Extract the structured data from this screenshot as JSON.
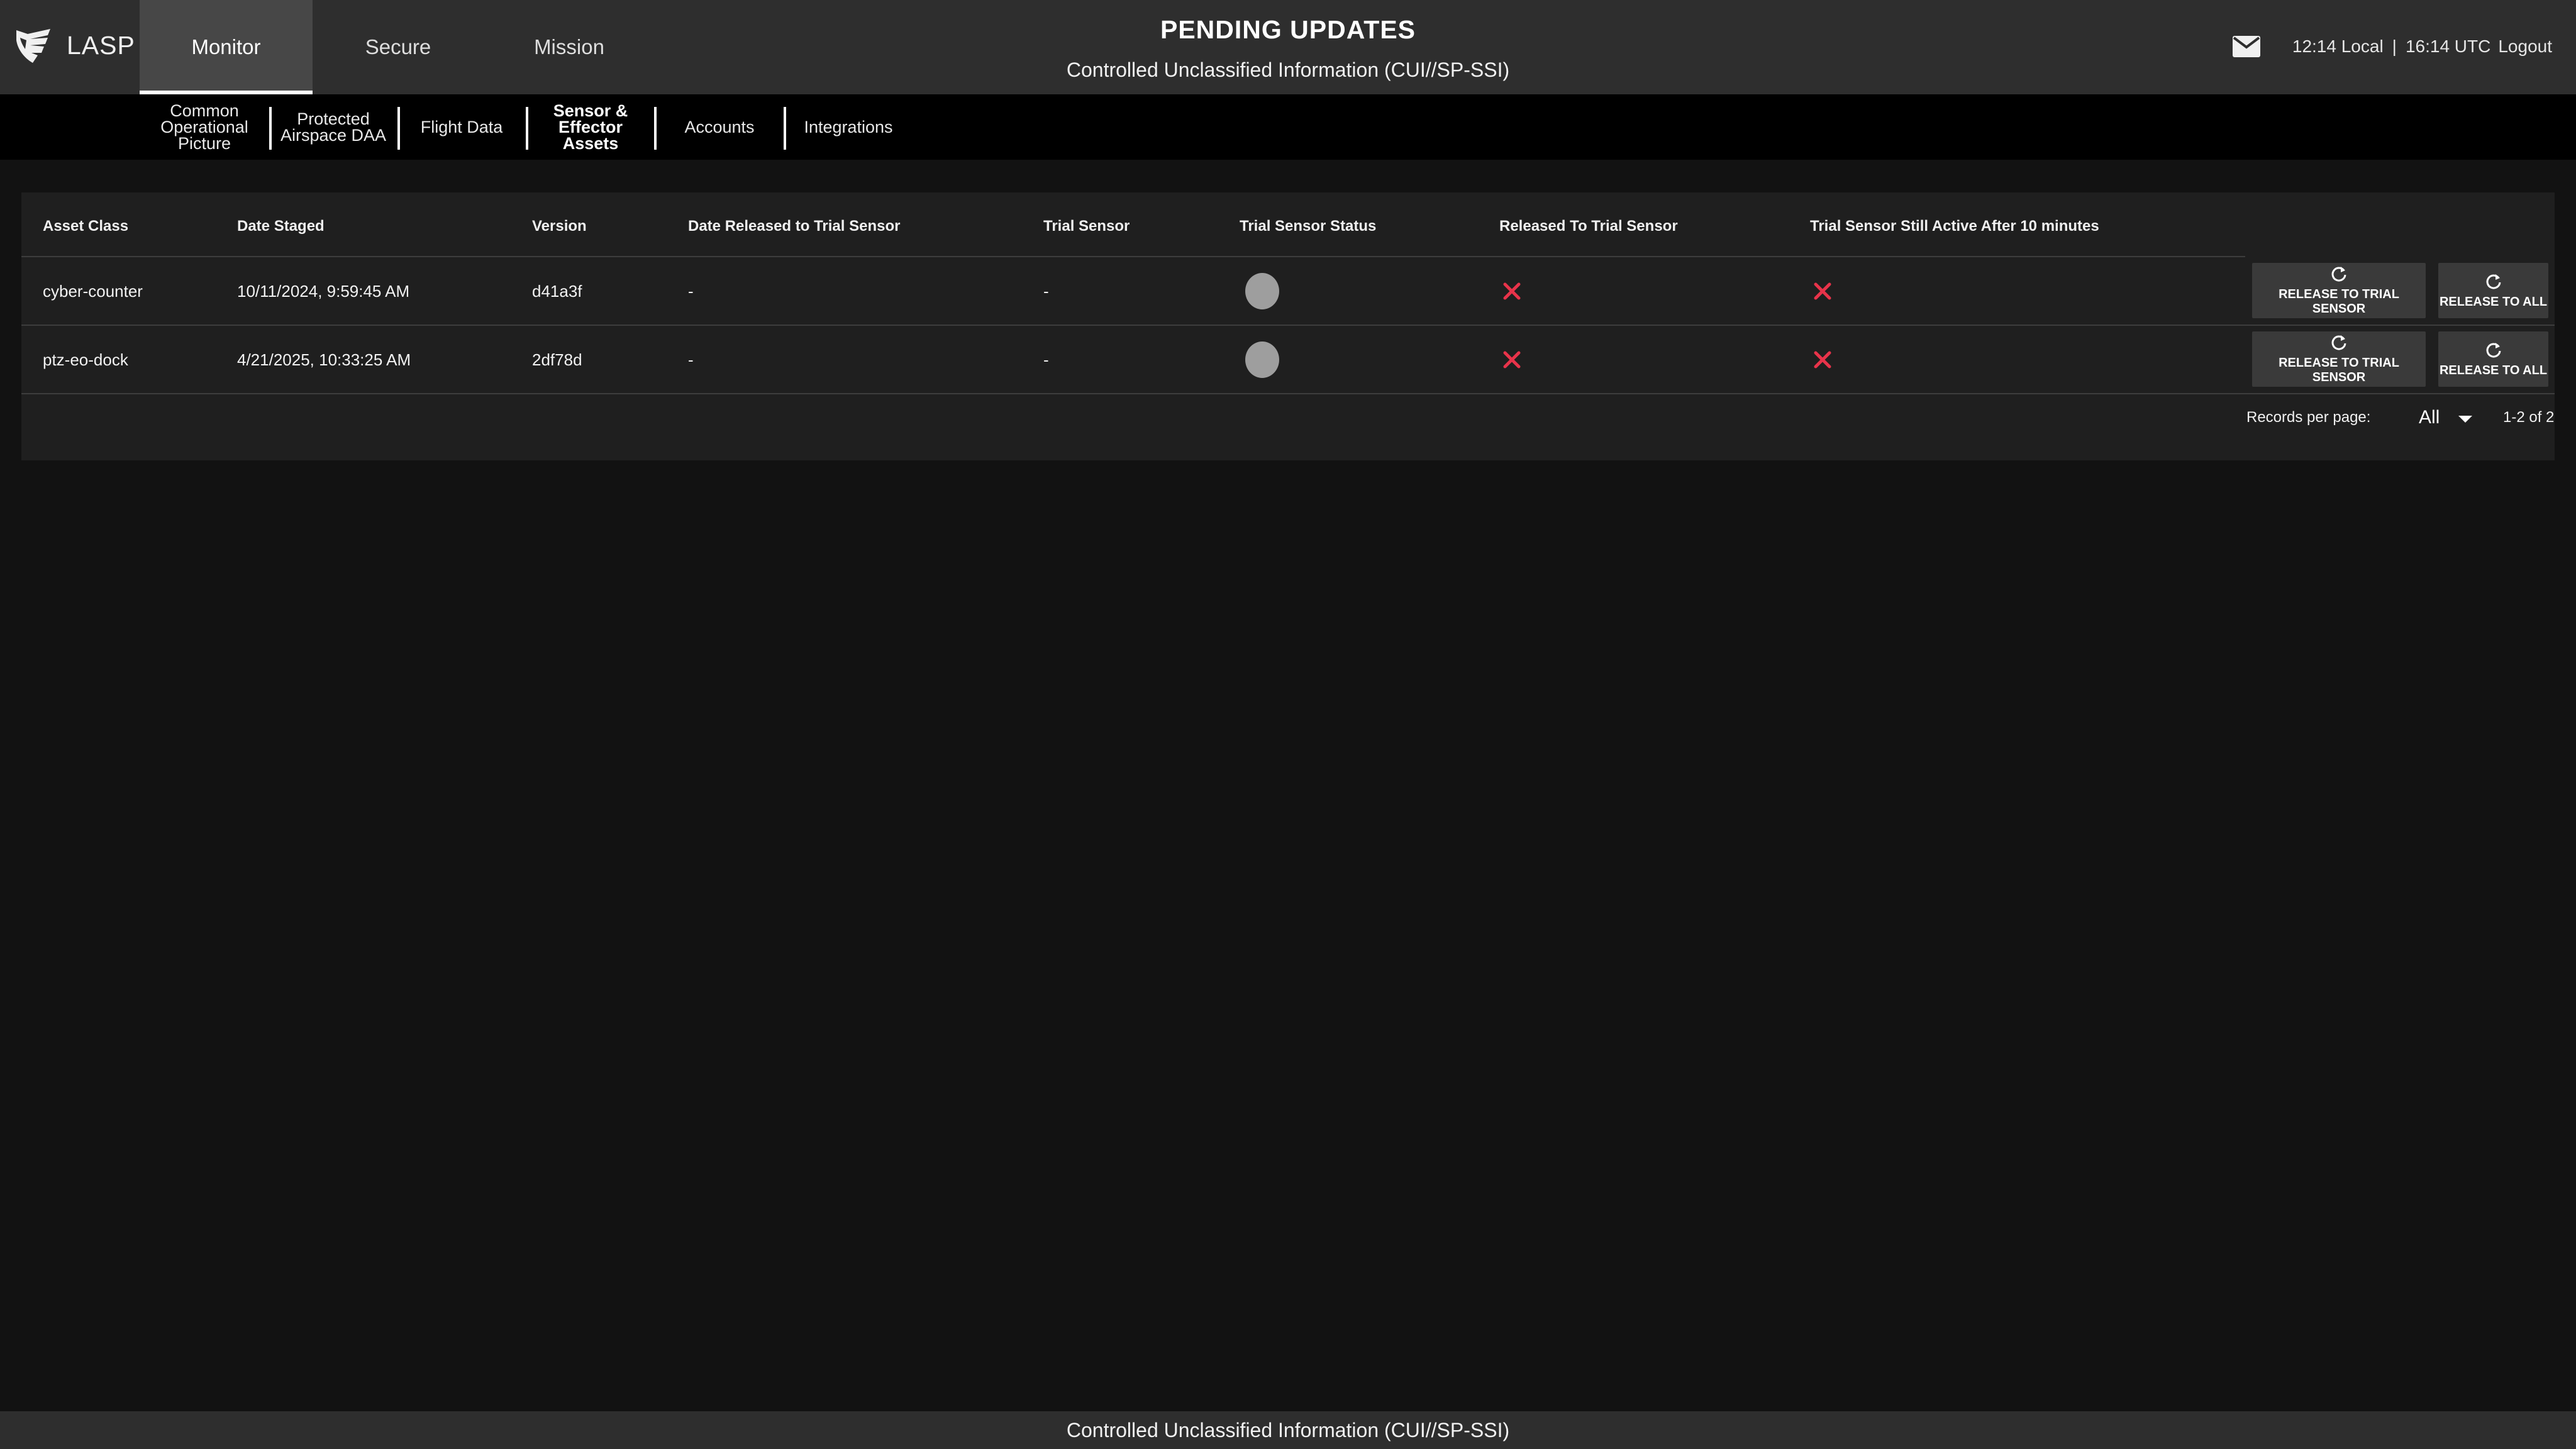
{
  "app": {
    "logo_text": "LASP",
    "page_title": "PENDING UPDATES",
    "classification": "Controlled Unclassified Information (CUI//SP-SSI)"
  },
  "main_tabs": [
    {
      "label": "Monitor",
      "active": true
    },
    {
      "label": "Secure",
      "active": false
    },
    {
      "label": "Mission",
      "active": false
    }
  ],
  "header_right": {
    "time_local": "12:14 Local",
    "separator": "|",
    "time_utc": "16:14 UTC",
    "logout": "Logout"
  },
  "subnav": [
    {
      "label": "Common Operational Picture",
      "active": false
    },
    {
      "label": "Protected Airspace DAA",
      "active": false
    },
    {
      "label": "Flight Data",
      "active": false
    },
    {
      "label": "Sensor & Effector Assets",
      "active": true
    },
    {
      "label": "Accounts",
      "active": false
    },
    {
      "label": "Integrations",
      "active": false
    }
  ],
  "table": {
    "columns": [
      "Asset Class",
      "Date Staged",
      "Version",
      "Date Released to Trial Sensor",
      "Trial Sensor",
      "Trial Sensor Status",
      "Released To Trial Sensor",
      "Trial Sensor Still Active After 10 minutes"
    ],
    "rows": [
      {
        "asset_class": "cyber-counter",
        "date_staged": "10/11/2024, 9:59:45 AM",
        "version": "d41a3f",
        "date_released": "-",
        "trial_sensor": "-",
        "status_color": "#9e9e9e",
        "released": false,
        "still_active": false,
        "btn_release_trial": "RELEASE TO TRIAL SENSOR",
        "btn_release_all": "RELEASE TO ALL"
      },
      {
        "asset_class": "ptz-eo-dock",
        "date_staged": "4/21/2025, 10:33:25 AM",
        "version": "2df78d",
        "date_released": "-",
        "trial_sensor": "-",
        "status_color": "#9e9e9e",
        "released": false,
        "still_active": false,
        "btn_release_trial": "RELEASE TO TRIAL SENSOR",
        "btn_release_all": "RELEASE TO ALL"
      }
    ],
    "records_per_page_label": "Records per page:",
    "records_per_page_value": "All",
    "page_range": "1-2 of 2"
  },
  "colors": {
    "x_mark": "#e8334a",
    "background": "#121212",
    "header": "#2e2e2e"
  },
  "icons": {
    "logo": "lasp-shield-icon",
    "mail": "mail-icon",
    "status": "status-dot",
    "negative": "x-mark-icon",
    "release": "refresh-icon"
  }
}
